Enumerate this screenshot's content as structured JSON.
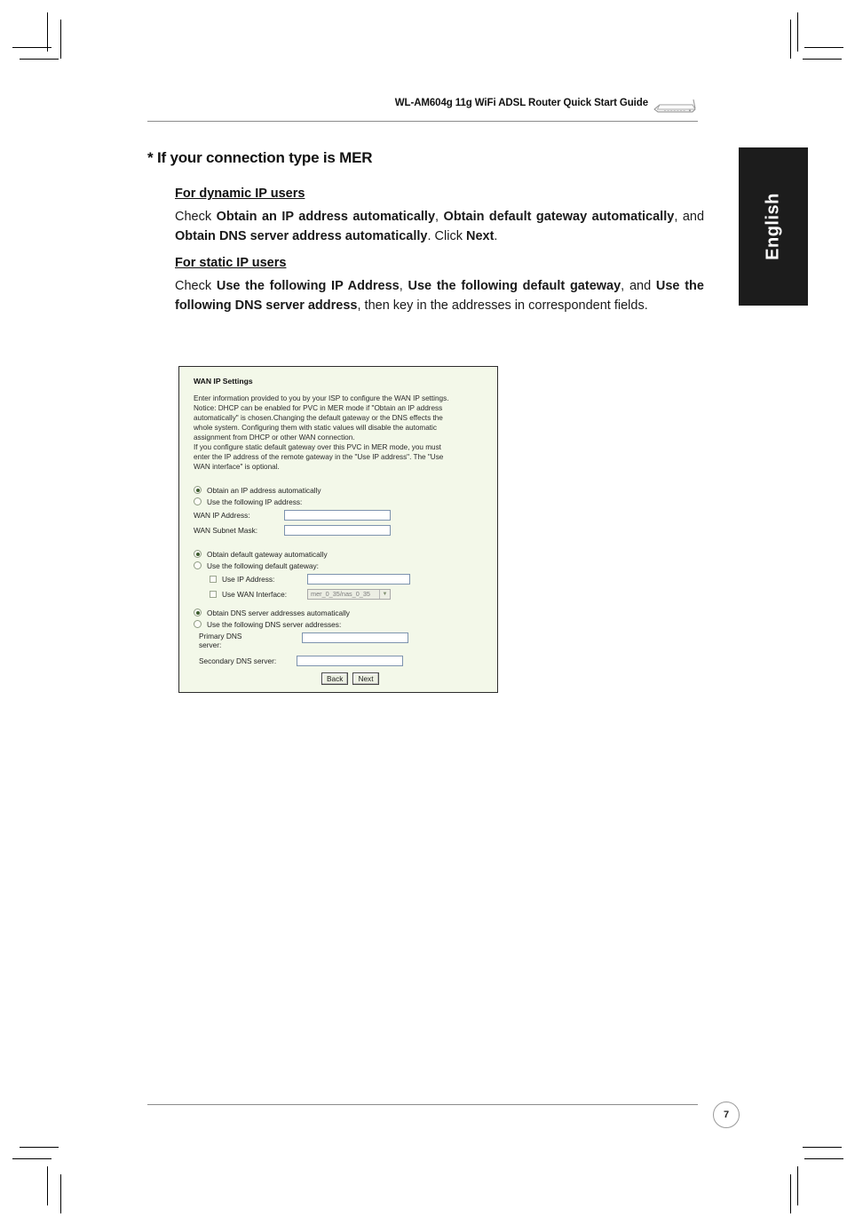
{
  "header": {
    "title": "WL-AM604g 11g WiFi ADSL Router Quick Start Guide",
    "device_icon": "router-icon"
  },
  "language_tab": {
    "label": "English"
  },
  "section": {
    "title": "* If your connection type is MER"
  },
  "content": {
    "dynamic_heading": "For dynamic IP users",
    "dynamic_paragraph": "Check <b>Obtain an IP address automatically</b>, <b>Obtain default gateway automatically</b>, and <b>Obtain DNS server address automatically</b>. Click <b>Next</b>.",
    "static_heading": "For static IP users",
    "static_paragraph": "Check <b>Use the following IP Address</b>, <b>Use the following default gateway</b>, and <b>Use the following DNS server address</b>, then key in the addresses in correspondent fields."
  },
  "ui_panel": {
    "title": "WAN IP Settings",
    "description_line1": "Enter information provided to you by your ISP to configure the WAN IP settings.",
    "description_line2": "Notice: DHCP can be enabled for PVC in MER mode if \"Obtain an IP address",
    "description_line3": "automatically\" is chosen.Changing the default gateway or the DNS effects the",
    "description_line4": "whole system. Configuring them with static values will disable the automatic",
    "description_line5": "assignment from DHCP or other WAN connection.",
    "description_line6": "If you configure static default gateway over this PVC in MER mode, you must",
    "description_line7": "enter the IP address of the remote gateway in the \"Use IP address\". The \"Use",
    "description_line8": "WAN interface\" is optional.",
    "ip_group": {
      "option_auto": "Obtain an IP address automatically",
      "option_manual": "Use the following IP address:",
      "field_ip_label": "WAN IP Address:",
      "field_ip_value": "",
      "field_mask_label": "WAN Subnet Mask:",
      "field_mask_value": ""
    },
    "gateway_group": {
      "option_auto": "Obtain default gateway automatically",
      "option_manual": "Use the following default gateway:",
      "check_use_ip": "Use IP Address:",
      "check_use_ip_value": "",
      "check_use_wan": "Use WAN Interface:",
      "wan_interface_value": "mer_0_35/nas_0_35"
    },
    "dns_group": {
      "option_auto": "Obtain DNS server addresses automatically",
      "option_manual": "Use the following DNS server addresses:",
      "primary_label_line1": "Primary DNS",
      "primary_label_line2": "server:",
      "primary_value": "",
      "secondary_label": "Secondary DNS server:",
      "secondary_value": ""
    },
    "buttons": {
      "back": "Back",
      "next": "Next"
    }
  },
  "footer": {
    "page_number": "7"
  },
  "colors": {
    "panel_background": "#f3f8e9",
    "panel_border": "#2d2d2d",
    "tab_background": "#1c1c1c",
    "input_border": "#7d93ae"
  }
}
